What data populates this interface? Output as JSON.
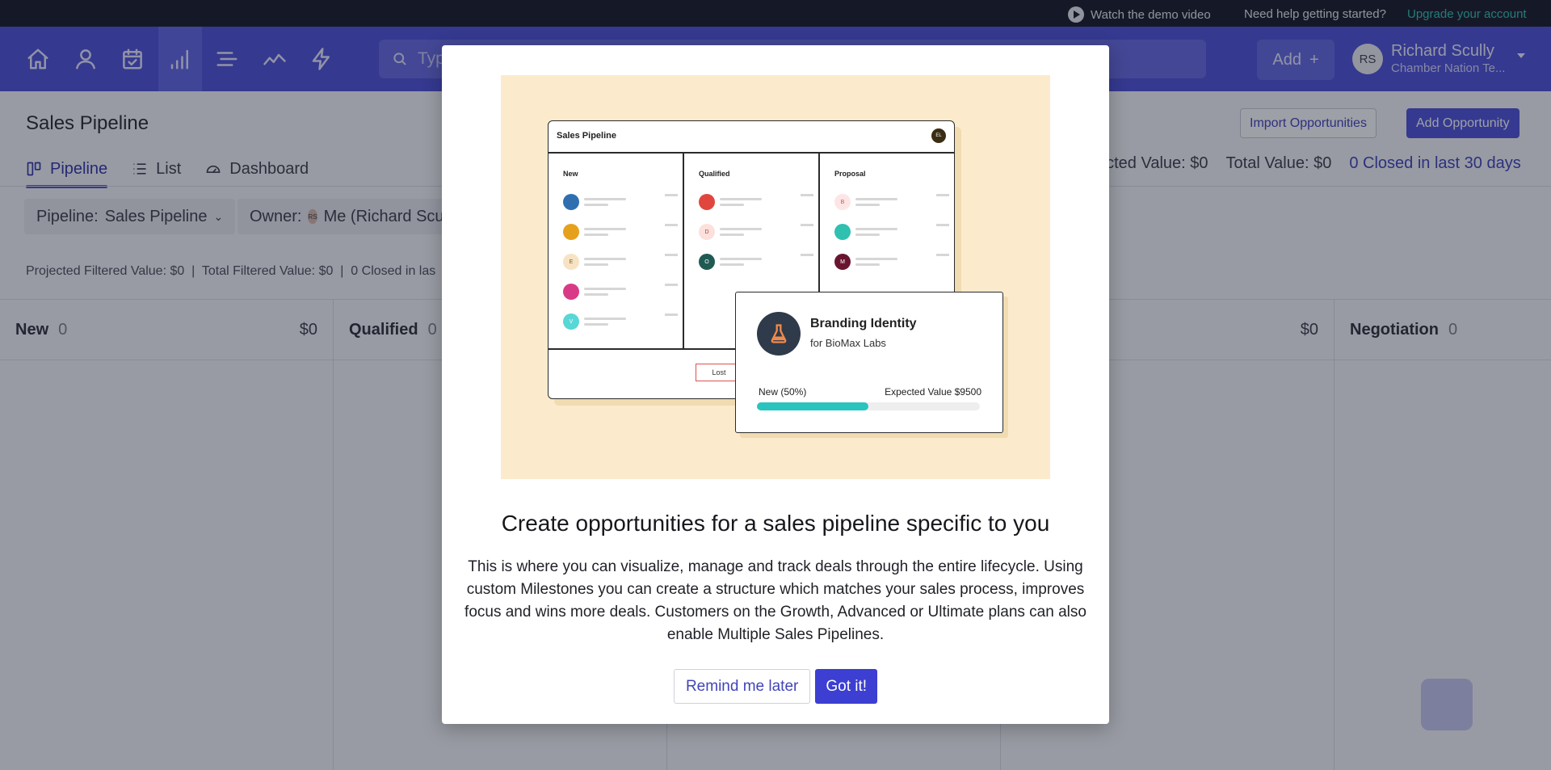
{
  "topbar": {
    "demo_label": "Watch the demo video",
    "help_label": "Need help getting started?",
    "upgrade_label": "Upgrade your account"
  },
  "nav": {
    "icons": [
      "home-icon",
      "contacts-icon",
      "calendar-check-icon",
      "pipeline-bars-icon",
      "list-icon",
      "trend-icon",
      "lightning-icon"
    ],
    "search_placeholder": "Typ",
    "add_label": "Add",
    "user": {
      "initials": "RS",
      "name": "Richard Scully",
      "org": "Chamber Nation Te..."
    }
  },
  "page": {
    "title": "Sales Pipeline",
    "import_label": "Import Opportunities",
    "add_opportunity_label": "Add Opportunity",
    "tabs": [
      {
        "label": "Pipeline",
        "icon": "pipeline-icon"
      },
      {
        "label": "List",
        "icon": "list-icon"
      },
      {
        "label": "Dashboard",
        "icon": "dashboard-gauge-icon"
      }
    ],
    "stats": {
      "projected": "ected Value: $0",
      "total": "Total Value: $0",
      "closed": "0 Closed in last 30 days"
    }
  },
  "filters": {
    "pipeline_label": "Pipeline:",
    "pipeline_value": "Sales Pipeline",
    "owner_label": "Owner:",
    "owner_avatar": "RS",
    "owner_value": "Me (Richard Scu",
    "summary": "Projected Filtered Value: $0  |  Total Filtered Value: $0  |  0 Closed in las"
  },
  "board": {
    "columns": [
      {
        "name": "New",
        "count": "0",
        "total": "$0"
      },
      {
        "name": "Qualified",
        "count": "0",
        "total": ""
      },
      {
        "name": "",
        "count": "",
        "total": ""
      },
      {
        "name": "",
        "count": "",
        "total": "$0"
      },
      {
        "name": "Negotiation",
        "count": "0",
        "total": ""
      }
    ]
  },
  "modal": {
    "illustration": {
      "board_title": "Sales Pipeline",
      "board_avatar": "EL",
      "col_new": "New",
      "col_qualified": "Qualified",
      "col_proposal": "Proposal",
      "lost_label": "Lost",
      "deal_title": "Branding Identity",
      "deal_sub": "for BioMax Labs",
      "deal_stage": "New (50%)",
      "deal_expected": "Expected Value $9500",
      "deal_progress": 0.5
    },
    "title": "Create opportunities for a sales pipeline specific to you",
    "body": "This is where you can visualize, manage and track deals through the entire lifecycle. Using custom Milestones you can create a structure which matches your sales process, improves focus and wins more deals. Customers on the Growth, Advanced or Ultimate plans can also enable Multiple Sales Pipelines.",
    "remind_label": "Remind me later",
    "got_label": "Got it!"
  },
  "colors": {
    "nav_bg": "#4b4fd6",
    "accent": "#3c3fd1",
    "topbar_bg": "#141824",
    "upgrade": "#2fc0b0",
    "illustration_bg": "#fbebcc",
    "progress": "#2ac4bf"
  }
}
